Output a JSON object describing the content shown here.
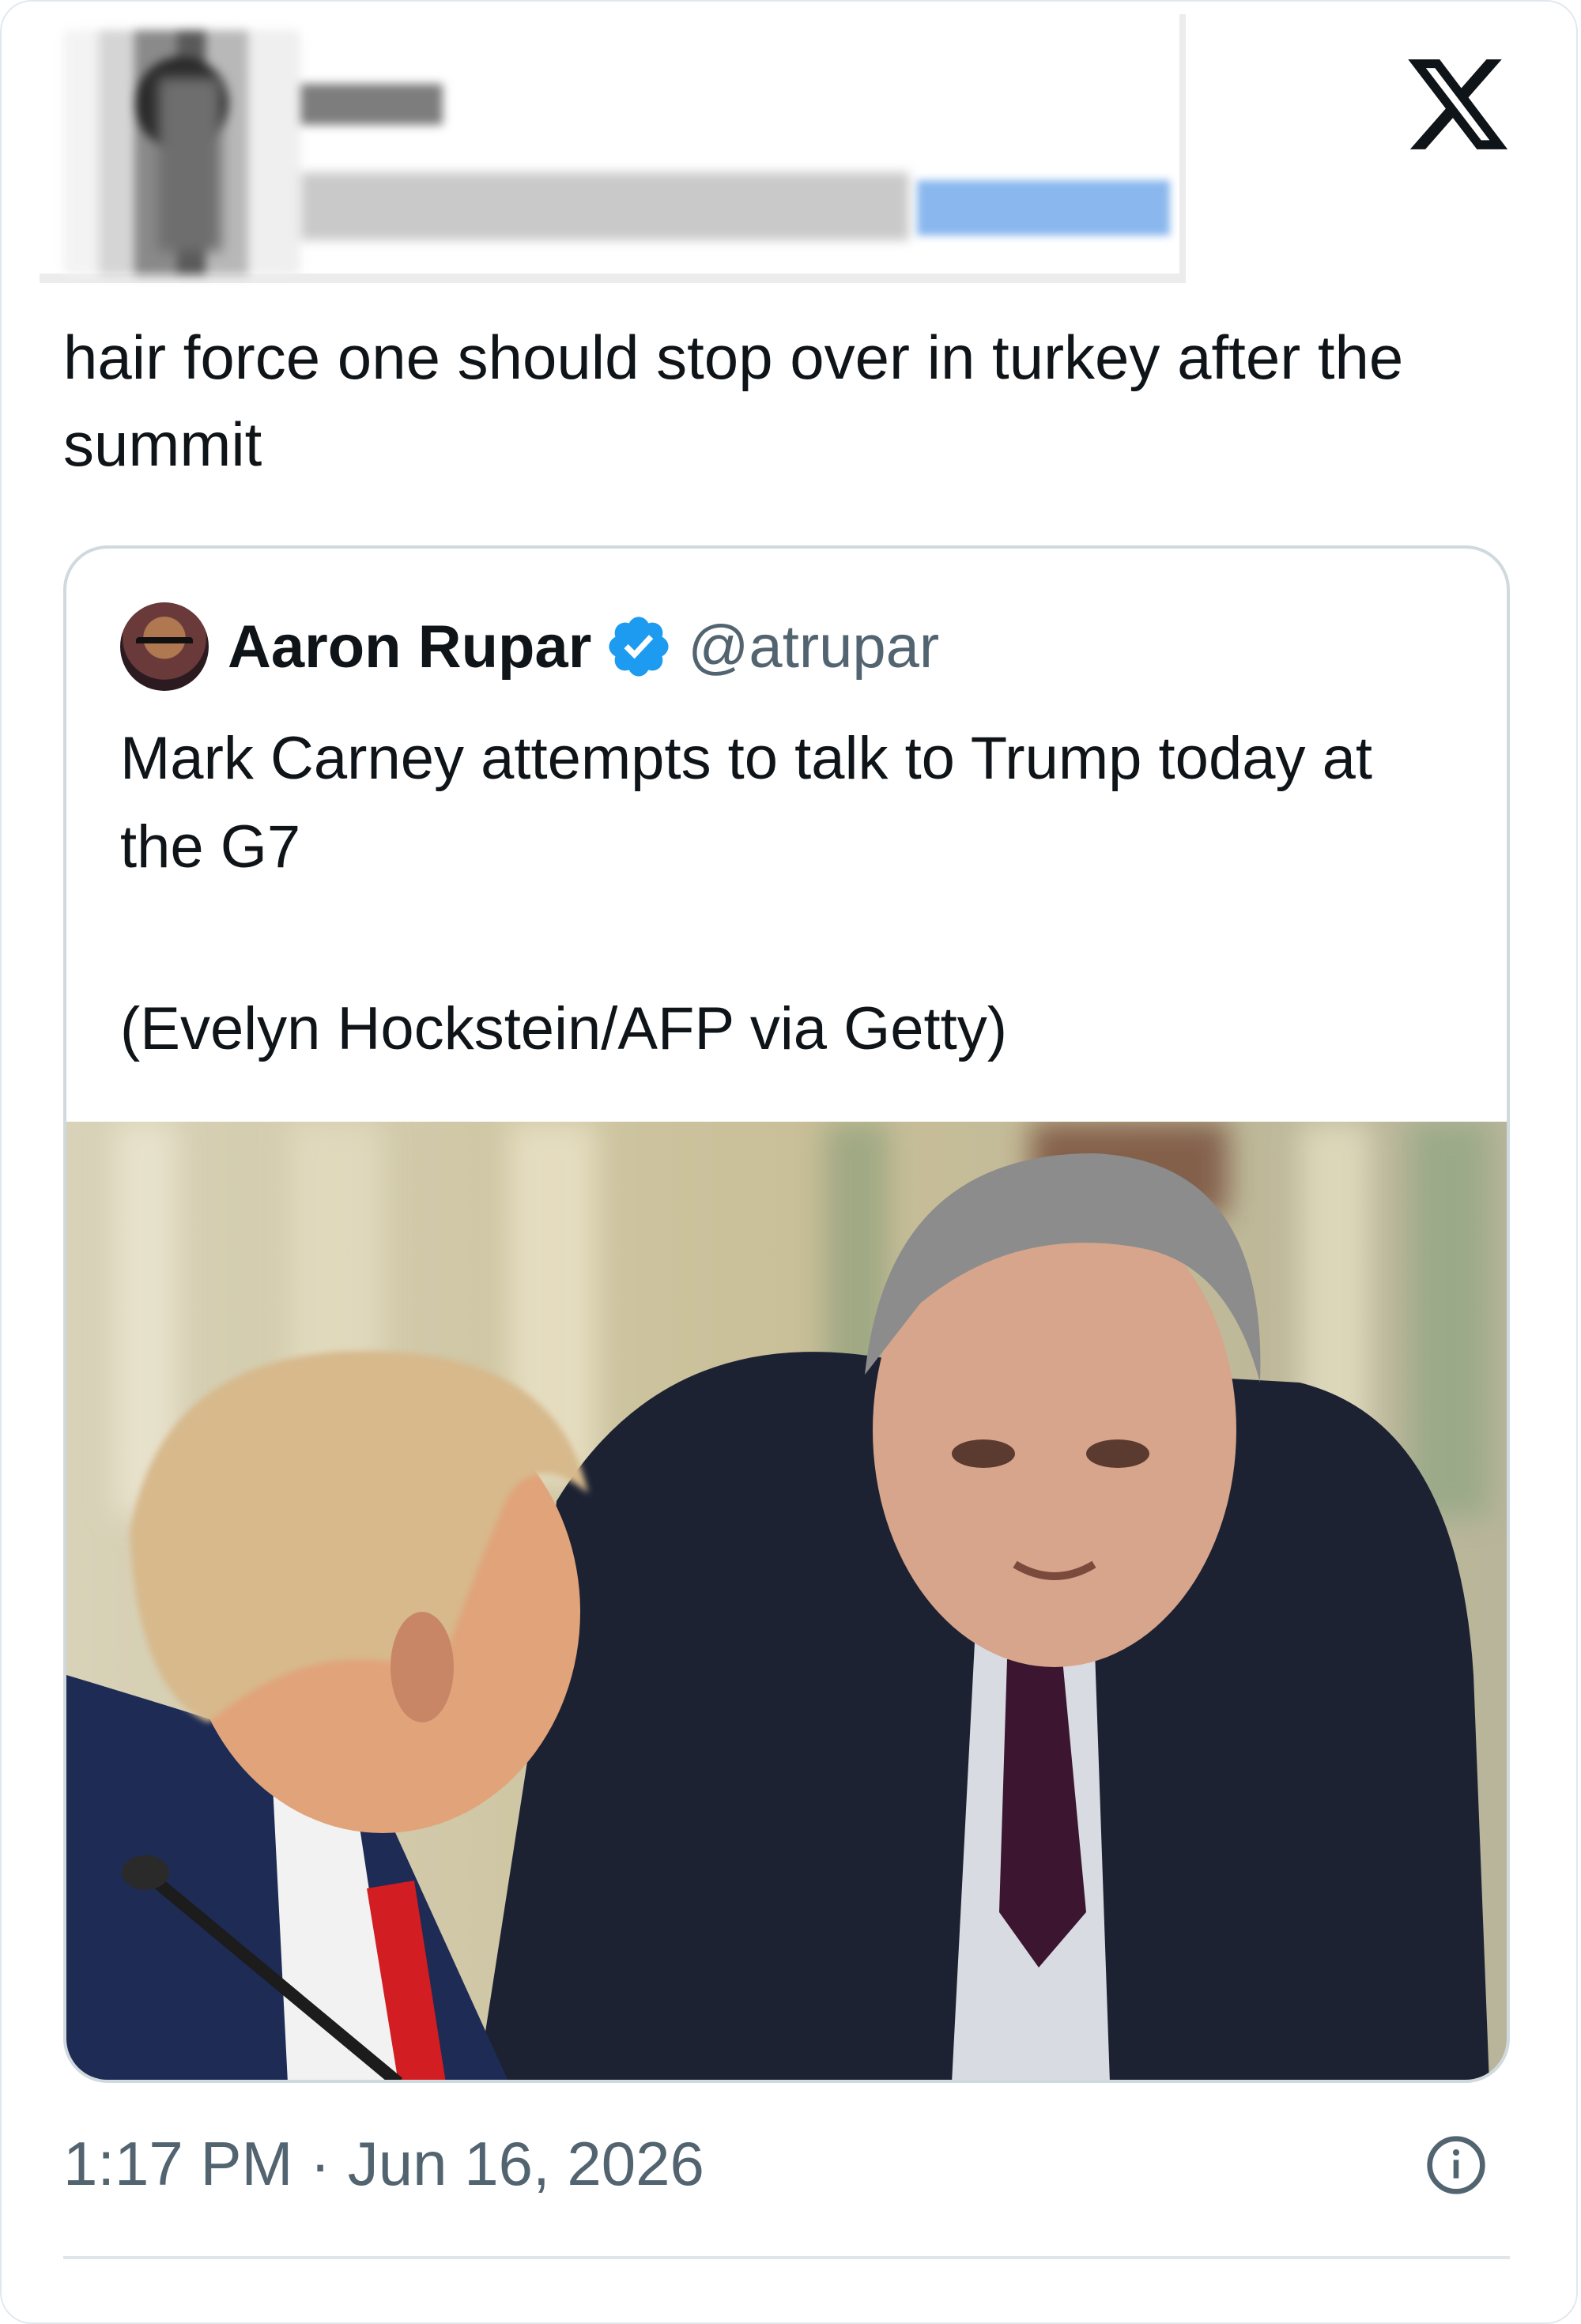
{
  "post": {
    "text": "hair force one should stop over in turkey after the summit",
    "timestamp": "1:17 PM · Jun 16, 2026",
    "platform_icon": "x-logo-icon"
  },
  "quoted_post": {
    "author_name": "Aaron Rupar",
    "author_handle": "@atrupar",
    "verified_icon": "verified-badge-icon",
    "text": "Mark Carney attempts to talk to Trump today at the G7",
    "photo_credit": "(Evelyn Hockstein/AFP via Getty)"
  },
  "colors": {
    "text_primary": "#0f1419",
    "text_secondary": "#536471",
    "verified_blue": "#1d9bf0",
    "border": "#cfd9de"
  }
}
